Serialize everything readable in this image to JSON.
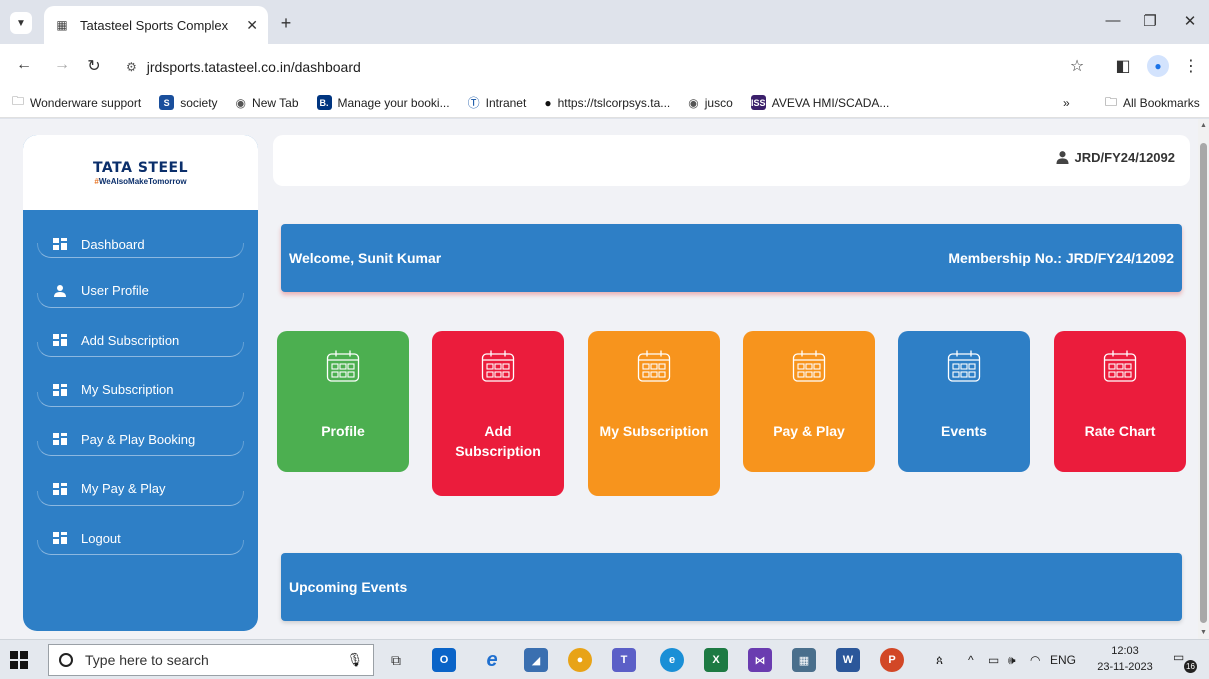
{
  "browser": {
    "tab_title": "Tatasteel Sports Complex",
    "url": "jrdsports.tatasteel.co.in/dashboard",
    "bookmarks": [
      {
        "label": "Wonderware support",
        "icon": "folder-icon"
      },
      {
        "label": "society",
        "icon": "society-logo-icon",
        "color": "#1a4f9c"
      },
      {
        "label": "New Tab",
        "icon": "globe-icon"
      },
      {
        "label": "Manage your booki...",
        "icon": "booking-logo-icon",
        "color": "#003580"
      },
      {
        "label": "Intranet",
        "icon": "tata-logo-icon"
      },
      {
        "label": "https://tslcorpsys.ta...",
        "icon": "github-icon"
      },
      {
        "label": "jusco",
        "icon": "globe-icon"
      },
      {
        "label": "AVEVA HMI/SCADA...",
        "icon": "iss-logo-icon",
        "color": "#3b1f6b"
      }
    ],
    "overflow_label": "»",
    "all_bookmarks": "All Bookmarks"
  },
  "logo": {
    "name": "TATA STEEL",
    "tagline_hash": "#",
    "tagline": "WeAlsoMakeTomorrow"
  },
  "sidebar": {
    "items": [
      {
        "label": "Dashboard",
        "icon": "grid-icon"
      },
      {
        "label": "User Profile",
        "icon": "user-icon"
      },
      {
        "label": "Add Subscription",
        "icon": "grid-icon"
      },
      {
        "label": "My Subscription",
        "icon": "grid-icon"
      },
      {
        "label": "Pay & Play Booking",
        "icon": "grid-icon"
      },
      {
        "label": "My Pay & Play",
        "icon": "grid-icon"
      },
      {
        "label": "Logout",
        "icon": "grid-icon"
      }
    ]
  },
  "header": {
    "membership_id": "JRD/FY24/12092"
  },
  "banner": {
    "welcome": "Welcome, Sunit Kumar",
    "membership": "Membership No.: JRD/FY24/12092"
  },
  "cards": [
    {
      "label": "Profile",
      "color": "#4caf50"
    },
    {
      "label": "Add Subscription",
      "color": "#eb1c3c"
    },
    {
      "label": "My Subscription",
      "color": "#f7941d"
    },
    {
      "label": "Pay & Play",
      "color": "#f7941d"
    },
    {
      "label": "Events",
      "color": "#2e7fc6"
    },
    {
      "label": "Rate Chart",
      "color": "#eb1c3c"
    }
  ],
  "events": {
    "title": "Upcoming Events"
  },
  "taskbar": {
    "search_placeholder": "Type here to search",
    "language": "ENG",
    "time": "12:03",
    "date": "23-11-2023",
    "notification_count": "16"
  }
}
